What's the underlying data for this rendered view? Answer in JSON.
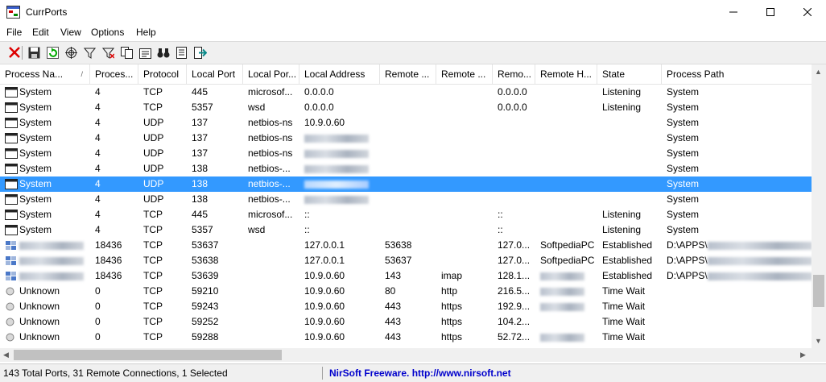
{
  "window": {
    "title": "CurrPorts",
    "minimize_icon": "minimize-icon",
    "maximize_icon": "maximize-icon",
    "close_icon": "close-icon"
  },
  "menu": [
    "File",
    "Edit",
    "View",
    "Options",
    "Help"
  ],
  "toolbar": [
    "delete-icon",
    "save-icon",
    "refresh-icon",
    "target-icon",
    "filter-icon",
    "red-filter-icon",
    "copy-icon",
    "properties-icon",
    "binoculars-icon",
    "html-report-icon",
    "exit-icon"
  ],
  "columns": [
    "Process Na...",
    "Proces...",
    "Protocol",
    "Local Port",
    "Local Por...",
    "Local Address",
    "Remote ...",
    "Remote ...",
    "Remo...",
    "Remote H...",
    "State",
    "Process Path"
  ],
  "sort_indicator": "/",
  "rows": [
    {
      "icon": "window",
      "name": "System",
      "pid": "4",
      "protocol": "TCP",
      "local_port": "445",
      "local_port_name": "microsof...",
      "local_address": "0.0.0.0",
      "remote_port": "",
      "remote_port_name": "",
      "remote_address": "0.0.0.0",
      "remote_host": "",
      "state": "Listening",
      "path": "System"
    },
    {
      "icon": "window",
      "name": "System",
      "pid": "4",
      "protocol": "TCP",
      "local_port": "5357",
      "local_port_name": "wsd",
      "local_address": "0.0.0.0",
      "remote_port": "",
      "remote_port_name": "",
      "remote_address": "0.0.0.0",
      "remote_host": "",
      "state": "Listening",
      "path": "System"
    },
    {
      "icon": "window",
      "name": "System",
      "pid": "4",
      "protocol": "UDP",
      "local_port": "137",
      "local_port_name": "netbios-ns",
      "local_address": "10.9.0.60",
      "remote_port": "",
      "remote_port_name": "",
      "remote_address": "",
      "remote_host": "",
      "state": "",
      "path": "System"
    },
    {
      "icon": "window",
      "name": "System",
      "pid": "4",
      "protocol": "UDP",
      "local_port": "137",
      "local_port_name": "netbios-ns",
      "local_address": "",
      "remote_port": "",
      "remote_port_name": "",
      "remote_address": "",
      "remote_host": "",
      "state": "",
      "path": "System",
      "blur_address": true
    },
    {
      "icon": "window",
      "name": "System",
      "pid": "4",
      "protocol": "UDP",
      "local_port": "137",
      "local_port_name": "netbios-ns",
      "local_address": "",
      "remote_port": "",
      "remote_port_name": "",
      "remote_address": "",
      "remote_host": "",
      "state": "",
      "path": "System",
      "blur_address": true
    },
    {
      "icon": "window",
      "name": "System",
      "pid": "4",
      "protocol": "UDP",
      "local_port": "138",
      "local_port_name": "netbios-...",
      "local_address": "",
      "remote_port": "",
      "remote_port_name": "",
      "remote_address": "",
      "remote_host": "",
      "state": "",
      "path": "System",
      "blur_address": true
    },
    {
      "icon": "window",
      "name": "System",
      "pid": "4",
      "protocol": "UDP",
      "local_port": "138",
      "local_port_name": "netbios-...",
      "local_address": "",
      "remote_port": "",
      "remote_port_name": "",
      "remote_address": "",
      "remote_host": "",
      "state": "",
      "path": "System",
      "blur_address": true,
      "selected": true
    },
    {
      "icon": "window",
      "name": "System",
      "pid": "4",
      "protocol": "UDP",
      "local_port": "138",
      "local_port_name": "netbios-...",
      "local_address": "",
      "remote_port": "",
      "remote_port_name": "",
      "remote_address": "",
      "remote_host": "",
      "state": "",
      "path": "System",
      "blur_address": true
    },
    {
      "icon": "window",
      "name": "System",
      "pid": "4",
      "protocol": "TCP",
      "local_port": "445",
      "local_port_name": "microsof...",
      "local_address": "::",
      "remote_port": "",
      "remote_port_name": "",
      "remote_address": "::",
      "remote_host": "",
      "state": "Listening",
      "path": "System"
    },
    {
      "icon": "window",
      "name": "System",
      "pid": "4",
      "protocol": "TCP",
      "local_port": "5357",
      "local_port_name": "wsd",
      "local_address": "::",
      "remote_port": "",
      "remote_port_name": "",
      "remote_address": "::",
      "remote_host": "",
      "state": "Listening",
      "path": "System"
    },
    {
      "icon": "app",
      "name": "",
      "pid": "18436",
      "protocol": "TCP",
      "local_port": "53637",
      "local_port_name": "",
      "local_address": "127.0.0.1",
      "remote_port": "53638",
      "remote_port_name": "",
      "remote_address": "127.0...",
      "remote_host": "SoftpediaPC",
      "state": "Established",
      "path": "D:\\APPS\\",
      "blur_name": true,
      "blur_path": true
    },
    {
      "icon": "app",
      "name": "",
      "pid": "18436",
      "protocol": "TCP",
      "local_port": "53638",
      "local_port_name": "",
      "local_address": "127.0.0.1",
      "remote_port": "53637",
      "remote_port_name": "",
      "remote_address": "127.0...",
      "remote_host": "SoftpediaPC",
      "state": "Established",
      "path": "D:\\APPS\\",
      "blur_name": true,
      "blur_path": true
    },
    {
      "icon": "app",
      "name": "",
      "pid": "18436",
      "protocol": "TCP",
      "local_port": "53639",
      "local_port_name": "",
      "local_address": "10.9.0.60",
      "remote_port": "143",
      "remote_port_name": "imap",
      "remote_address": "128.1...",
      "remote_host": "",
      "state": "Established",
      "path": "D:\\APPS\\",
      "blur_name": true,
      "blur_path": true,
      "blur_host": true
    },
    {
      "icon": "circle",
      "name": "Unknown",
      "pid": "0",
      "protocol": "TCP",
      "local_port": "59210",
      "local_port_name": "",
      "local_address": "10.9.0.60",
      "remote_port": "80",
      "remote_port_name": "http",
      "remote_address": "216.5...",
      "remote_host": "",
      "state": "Time Wait",
      "path": "",
      "blur_host": true
    },
    {
      "icon": "circle",
      "name": "Unknown",
      "pid": "0",
      "protocol": "TCP",
      "local_port": "59243",
      "local_port_name": "",
      "local_address": "10.9.0.60",
      "remote_port": "443",
      "remote_port_name": "https",
      "remote_address": "192.9...",
      "remote_host": "",
      "state": "Time Wait",
      "path": "",
      "blur_host": true
    },
    {
      "icon": "circle",
      "name": "Unknown",
      "pid": "0",
      "protocol": "TCP",
      "local_port": "59252",
      "local_port_name": "",
      "local_address": "10.9.0.60",
      "remote_port": "443",
      "remote_port_name": "https",
      "remote_address": "104.2...",
      "remote_host": "",
      "state": "Time Wait",
      "path": ""
    },
    {
      "icon": "circle",
      "name": "Unknown",
      "pid": "0",
      "protocol": "TCP",
      "local_port": "59288",
      "local_port_name": "",
      "local_address": "10.9.0.60",
      "remote_port": "443",
      "remote_port_name": "https",
      "remote_address": "52.72...",
      "remote_host": "",
      "state": "Time Wait",
      "path": "",
      "blur_host": true
    }
  ],
  "status": {
    "summary": "143 Total Ports, 31 Remote Connections, 1 Selected",
    "link": "NirSoft Freeware.  http://www.nirsoft.net"
  },
  "colors": {
    "selection": "#3399ff",
    "link": "#0000cc"
  }
}
